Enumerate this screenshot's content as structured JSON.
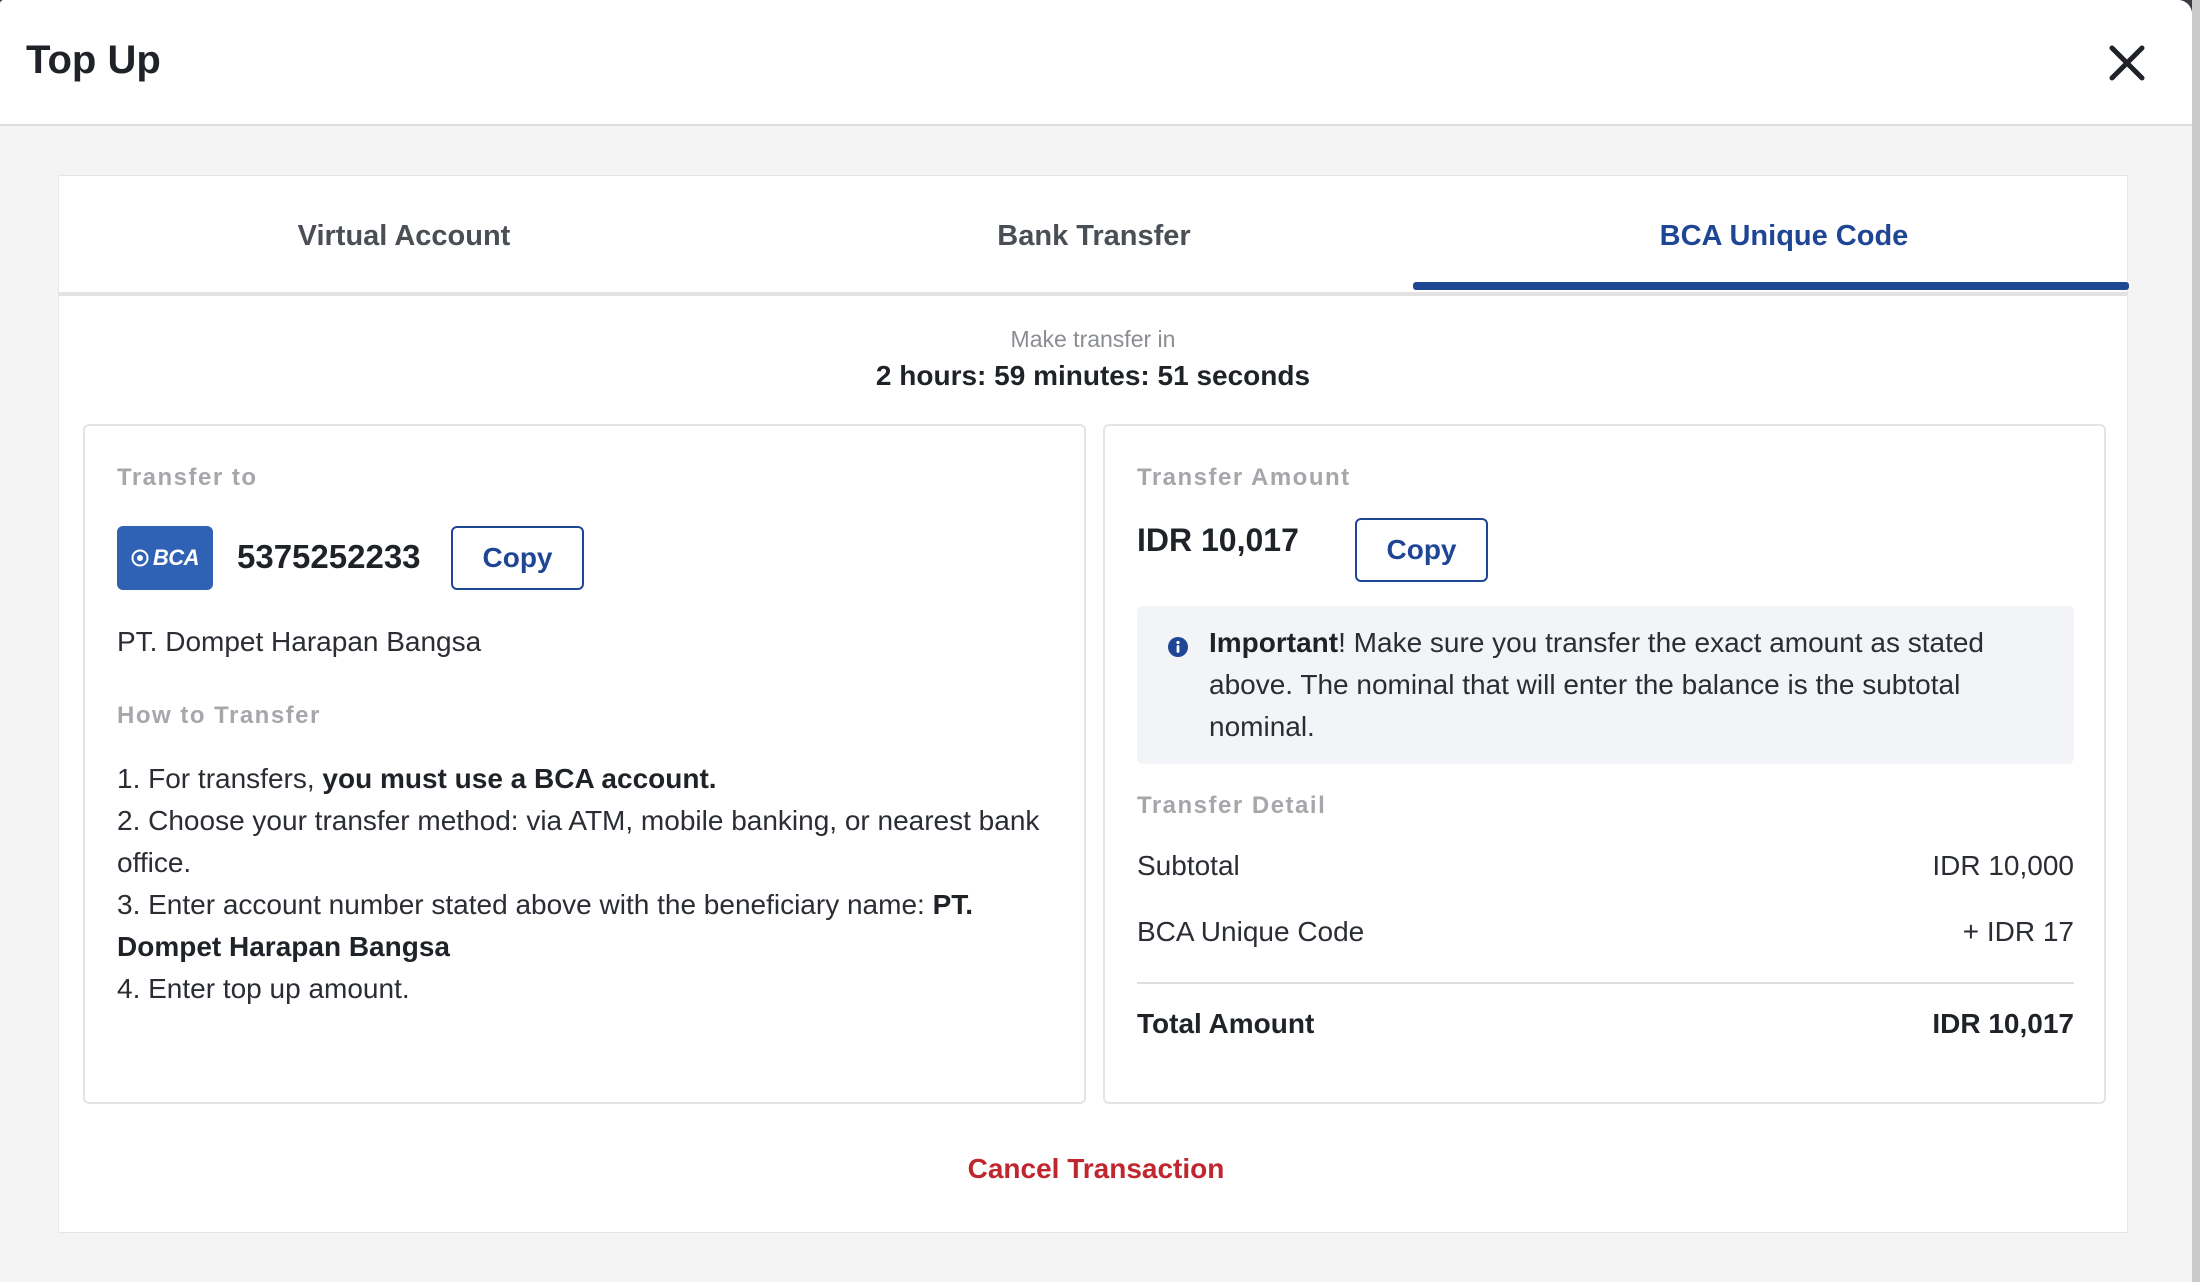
{
  "modal": {
    "title": "Top Up",
    "close_icon": "close-icon"
  },
  "tabs": [
    {
      "label": "Virtual Account",
      "active": false
    },
    {
      "label": "Bank Transfer",
      "active": false
    },
    {
      "label": "BCA Unique Code",
      "active": true
    }
  ],
  "timer": {
    "label": "Make transfer in",
    "value": "2 hours: 59 minutes: 51 seconds"
  },
  "transfer_to": {
    "section_label": "Transfer to",
    "bank_logo_text": "BCA",
    "account_number": "5375252233",
    "copy_label": "Copy",
    "beneficiary": "PT. Dompet Harapan Bangsa"
  },
  "how_to": {
    "section_label": "How to Transfer",
    "step1_prefix": "1. For transfers, ",
    "step1_bold": "you must use a BCA account.",
    "step2": "2. Choose your transfer method: via ATM, mobile banking, or nearest bank office.",
    "step3_prefix": "3. Enter account number stated above with the beneficiary name: ",
    "step3_bold": "PT. Dompet Harapan Bangsa",
    "step4": "4. Enter top up amount."
  },
  "transfer_amount": {
    "section_label": "Transfer Amount",
    "value": "IDR 10,017",
    "copy_label": "Copy"
  },
  "notice": {
    "icon": "info-icon",
    "bold": "Important",
    "text": "! Make sure you transfer the exact amount as stated above. The nominal that will enter the balance is the subtotal nominal."
  },
  "transfer_detail": {
    "section_label": "Transfer Detail",
    "rows": [
      {
        "label": "Subtotal",
        "value": "IDR 10,000"
      },
      {
        "label": "BCA Unique Code",
        "value": "+ IDR 17"
      }
    ],
    "total": {
      "label": "Total Amount",
      "value": "IDR 10,017"
    }
  },
  "cancel_label": "Cancel Transaction",
  "colors": {
    "accent": "#1e4694",
    "cancel": "#c0262d",
    "bca_logo": "#2f62b4"
  }
}
